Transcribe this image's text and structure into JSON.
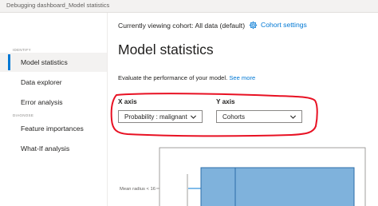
{
  "window": {
    "title": "Debugging dashboard_Model statistics"
  },
  "sidebar": {
    "sections": [
      {
        "label": "IDENTIFY"
      },
      {
        "label": "DIAGNOSE"
      }
    ],
    "items": [
      {
        "label": "Model statistics",
        "selected": true
      },
      {
        "label": "Data explorer"
      },
      {
        "label": "Error analysis"
      },
      {
        "label": "Feature importances"
      },
      {
        "label": "What-If analysis"
      }
    ]
  },
  "header": {
    "cohort_text": "Currently viewing cohort: All data (default)",
    "cohort_settings_label": "Cohort settings",
    "accent_color": "#0078d4"
  },
  "main": {
    "title": "Model statistics",
    "description": "Evaluate the performance of your model.",
    "see_more_label": "See more",
    "x_axis": {
      "label": "X axis",
      "selected_value": "Probability : malignant"
    },
    "y_axis": {
      "label": "Y axis",
      "selected_value": "Cohorts"
    },
    "annotation_color": "#e81123",
    "chart": {
      "category_label": "Mean radius < 16",
      "box_color": "#7fb2dc"
    }
  },
  "icons": {
    "cohort_settings": "gear-icon",
    "dropdown": "chevron-down-icon"
  }
}
